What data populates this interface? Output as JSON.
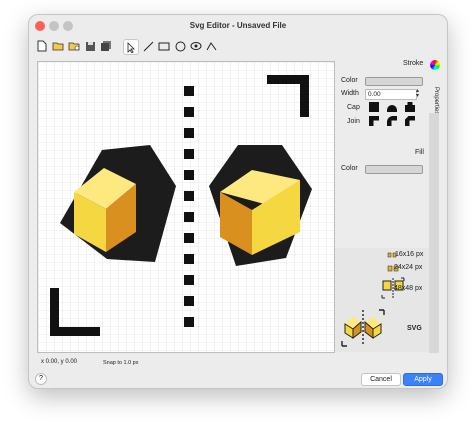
{
  "window": {
    "title": "Svg Editor - Unsaved File"
  },
  "toolbar": {
    "icons": [
      "new-file-icon",
      "open-folder-icon",
      "open-recent-icon",
      "save-icon",
      "save-all-icon",
      "pointer-tool-icon",
      "line-tool-icon",
      "rect-tool-icon",
      "ellipse-tool-icon",
      "eye-tool-icon",
      "path-tool-icon"
    ]
  },
  "status": {
    "coords": "x 0.00, y 0.00",
    "snap": "Snap to 1.0 px"
  },
  "properties": {
    "tab_label": "Properties",
    "stroke": {
      "heading": "Stroke",
      "color_label": "Color",
      "width_label": "Width",
      "width_value": "0.00",
      "cap_label": "Cap",
      "join_label": "Join"
    },
    "fill": {
      "heading": "Fill",
      "color_label": "Color"
    }
  },
  "preview": {
    "sizes": [
      "16x16 px",
      "24x24 px",
      "48x48 px"
    ],
    "svg_label": "SVG"
  },
  "footer": {
    "help": "?",
    "cancel": "Cancel",
    "apply": "Apply"
  },
  "colors": {
    "accent": "#3b82f6",
    "cube_top": "#fde980",
    "cube_front": "#f5d742",
    "cube_side": "#d9901f",
    "hex": "#1c1c1c"
  }
}
